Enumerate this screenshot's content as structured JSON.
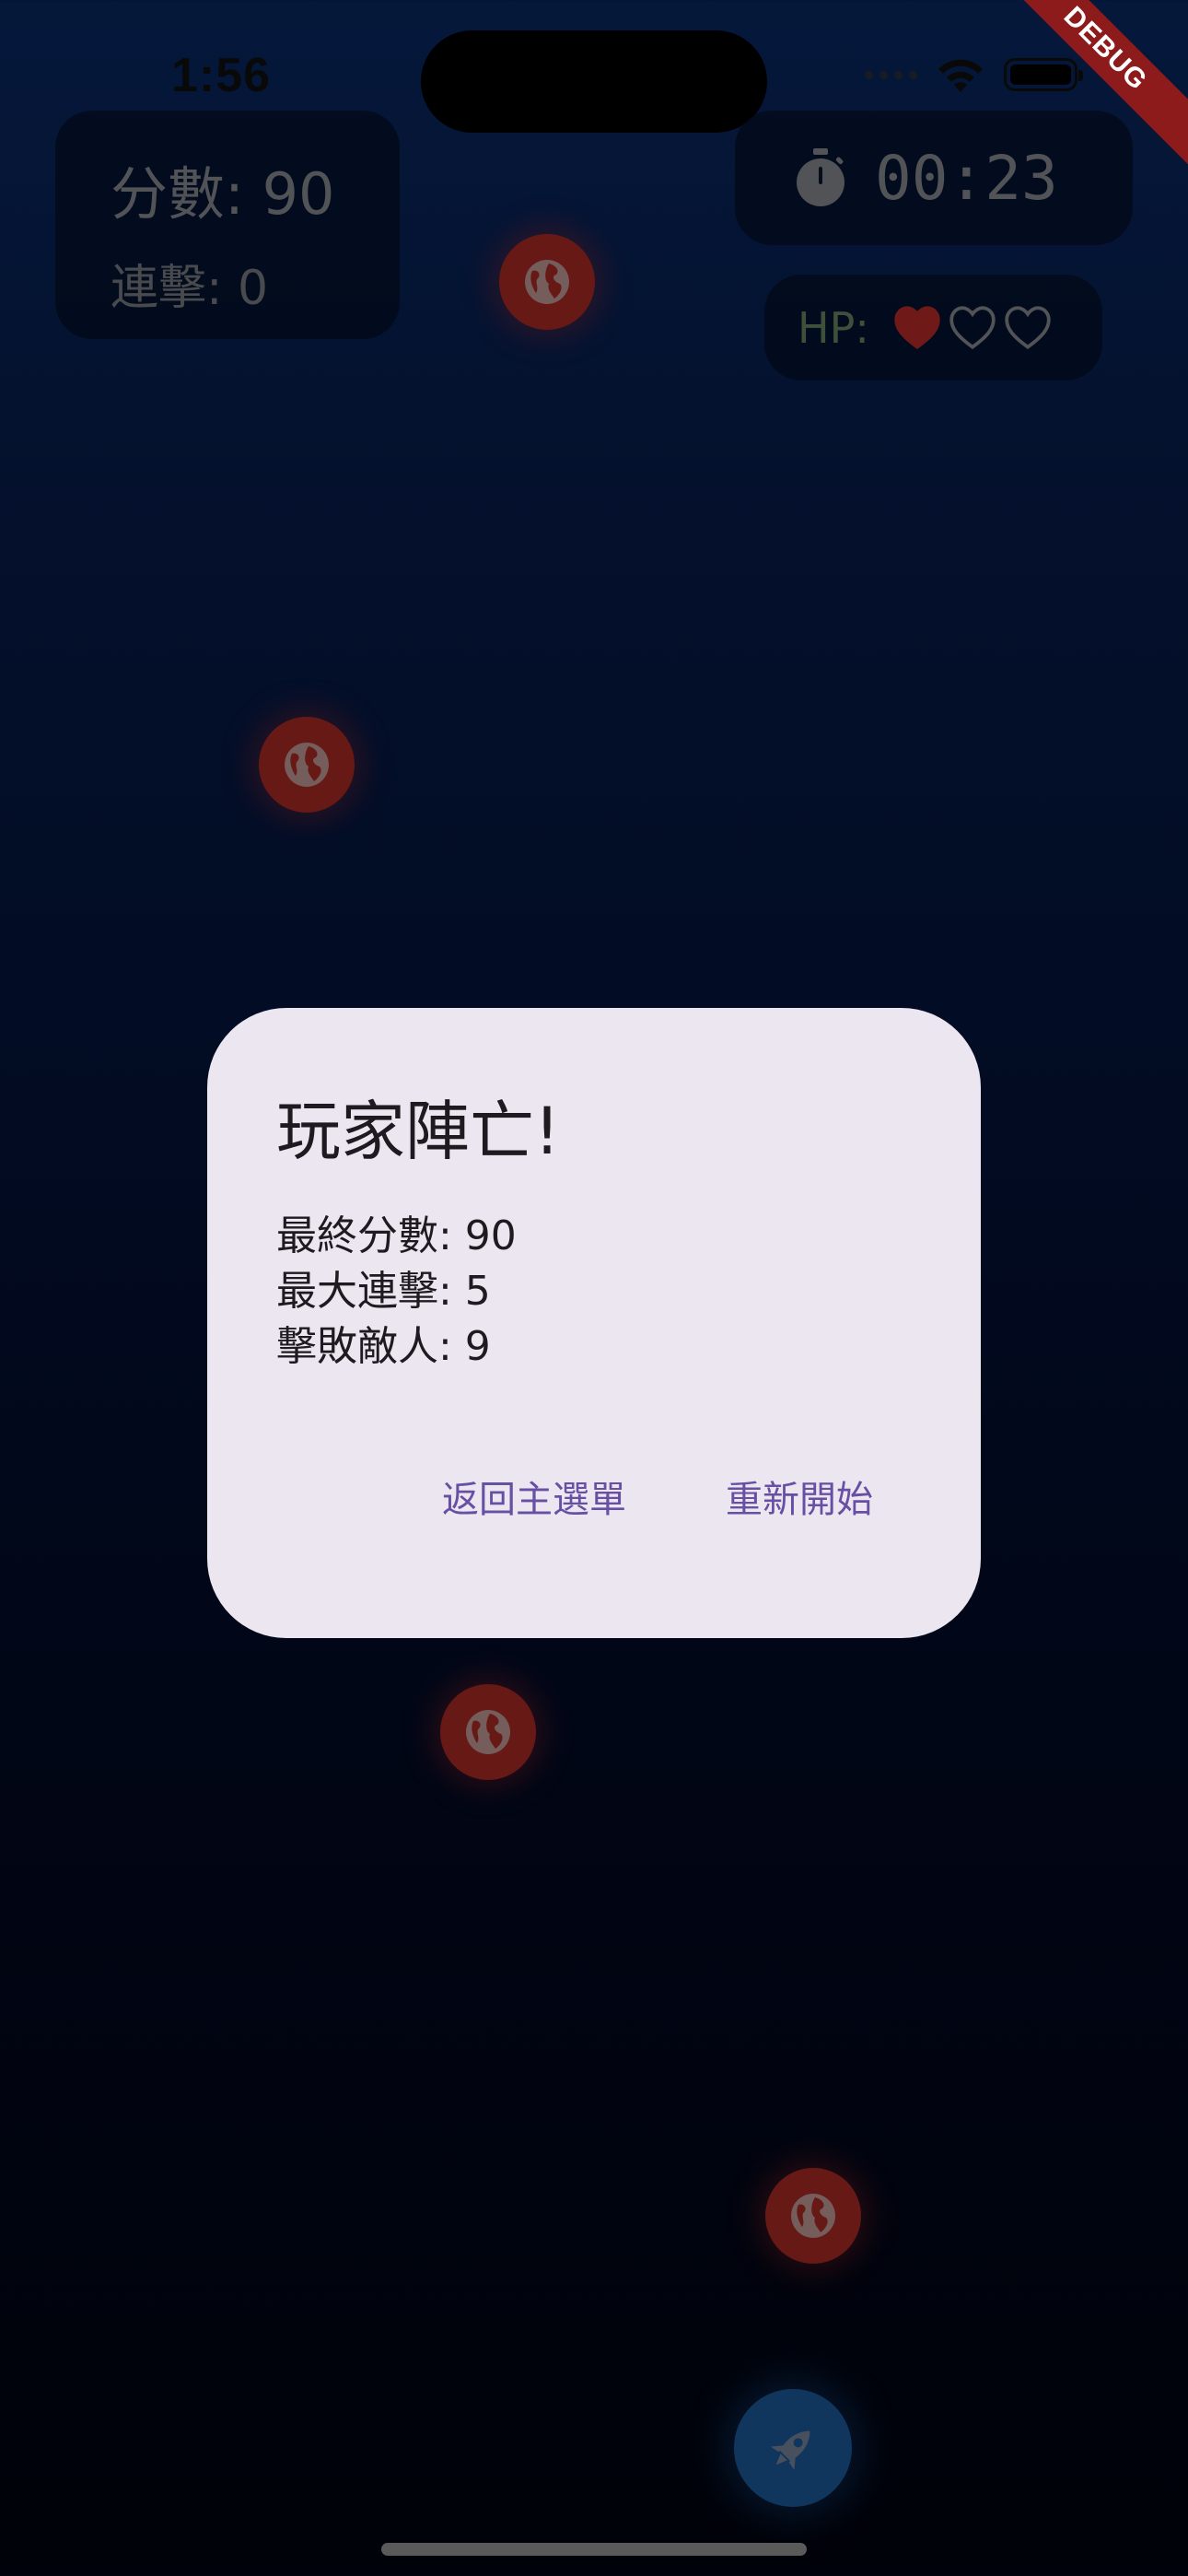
{
  "status_bar": {
    "time": "1:56",
    "icons": [
      "signal-dots-icon",
      "wifi-icon",
      "battery-icon"
    ]
  },
  "debug_banner": "DEBUG",
  "hud": {
    "score": "分數: 90",
    "combo": "連擊: 0",
    "timer": "00:23",
    "timer_icon": "stopwatch-icon",
    "hp_label": "HP:",
    "hp_current": 1,
    "hp_max": 3
  },
  "dialog": {
    "title": "玩家陣亡!",
    "stats": [
      "最終分數: 90",
      "最大連擊: 5",
      "擊敗敵人: 9"
    ],
    "buttons": {
      "main_menu": "返回主選單",
      "restart": "重新開始"
    }
  },
  "game": {
    "enemy_icon": "globe-icon",
    "player_icon": "rocket-icon"
  },
  "colors": {
    "enemy": "#b22c27",
    "player": "#1e5da3",
    "dialog_bg": "#ece6f0",
    "button_text": "#6750a4",
    "heart_full": "#c22c2c"
  }
}
